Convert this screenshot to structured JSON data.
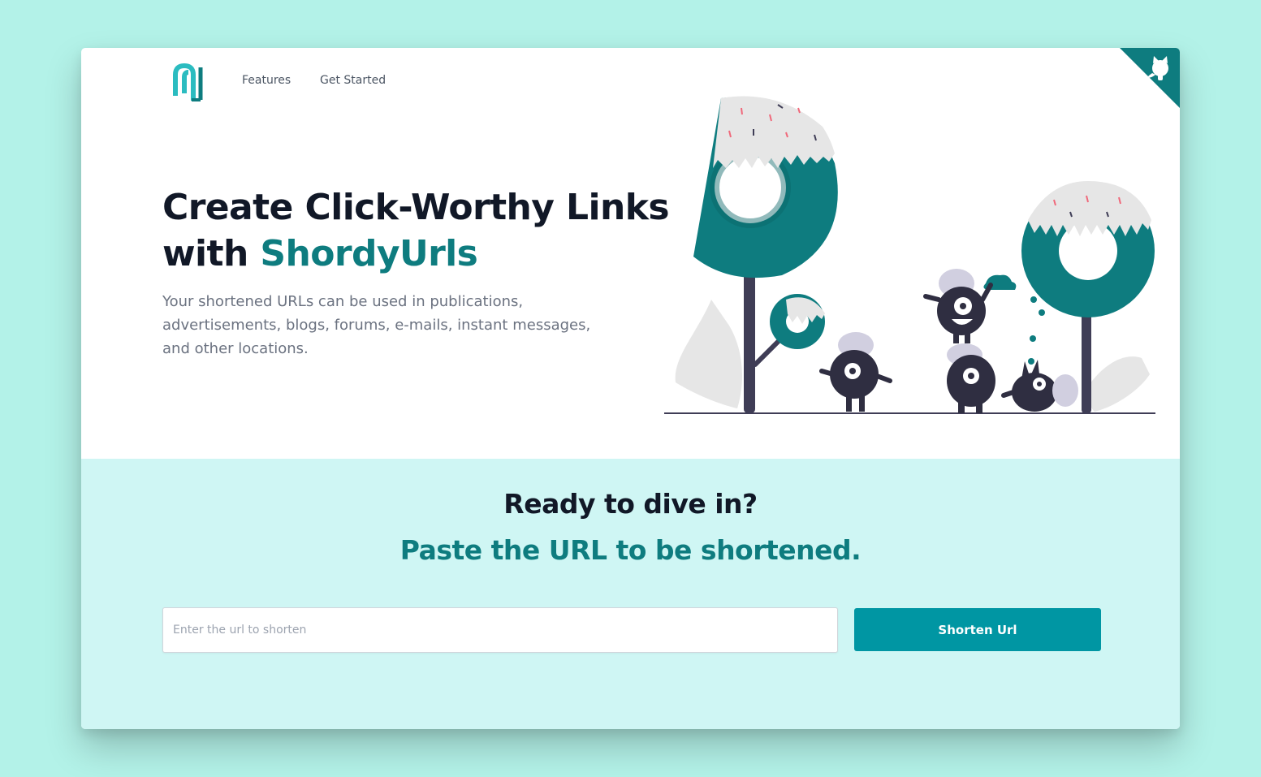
{
  "nav": {
    "logo_icon": "shordyurls-logo-icon",
    "links": [
      {
        "label": "Features"
      },
      {
        "label": "Get Started"
      }
    ],
    "github_icon": "github-octocat-icon"
  },
  "hero": {
    "headline_line1": "Create Click-Worthy Links",
    "headline_with": "with",
    "headline_brand": "ShordyUrls",
    "description": "Your shortened URLs can be used in publications, advertisements, blogs, forums, e-mails, instant messages, and other locations.",
    "illustration": "donut-trees-monsters-illustration"
  },
  "cta": {
    "title": "Ready to dive in?",
    "subtitle": "Paste the URL to be shortened.",
    "input_value": "",
    "input_placeholder": "Enter the url to shorten",
    "button_label": "Shorten Url"
  },
  "colors": {
    "page_background": "#b3f2e8",
    "brand_teal": "#0e7c7f",
    "button_teal": "#0096a3",
    "cta_background": "#cff6f4",
    "heading_dark": "#111827",
    "monster_dark": "#2f2e41"
  }
}
